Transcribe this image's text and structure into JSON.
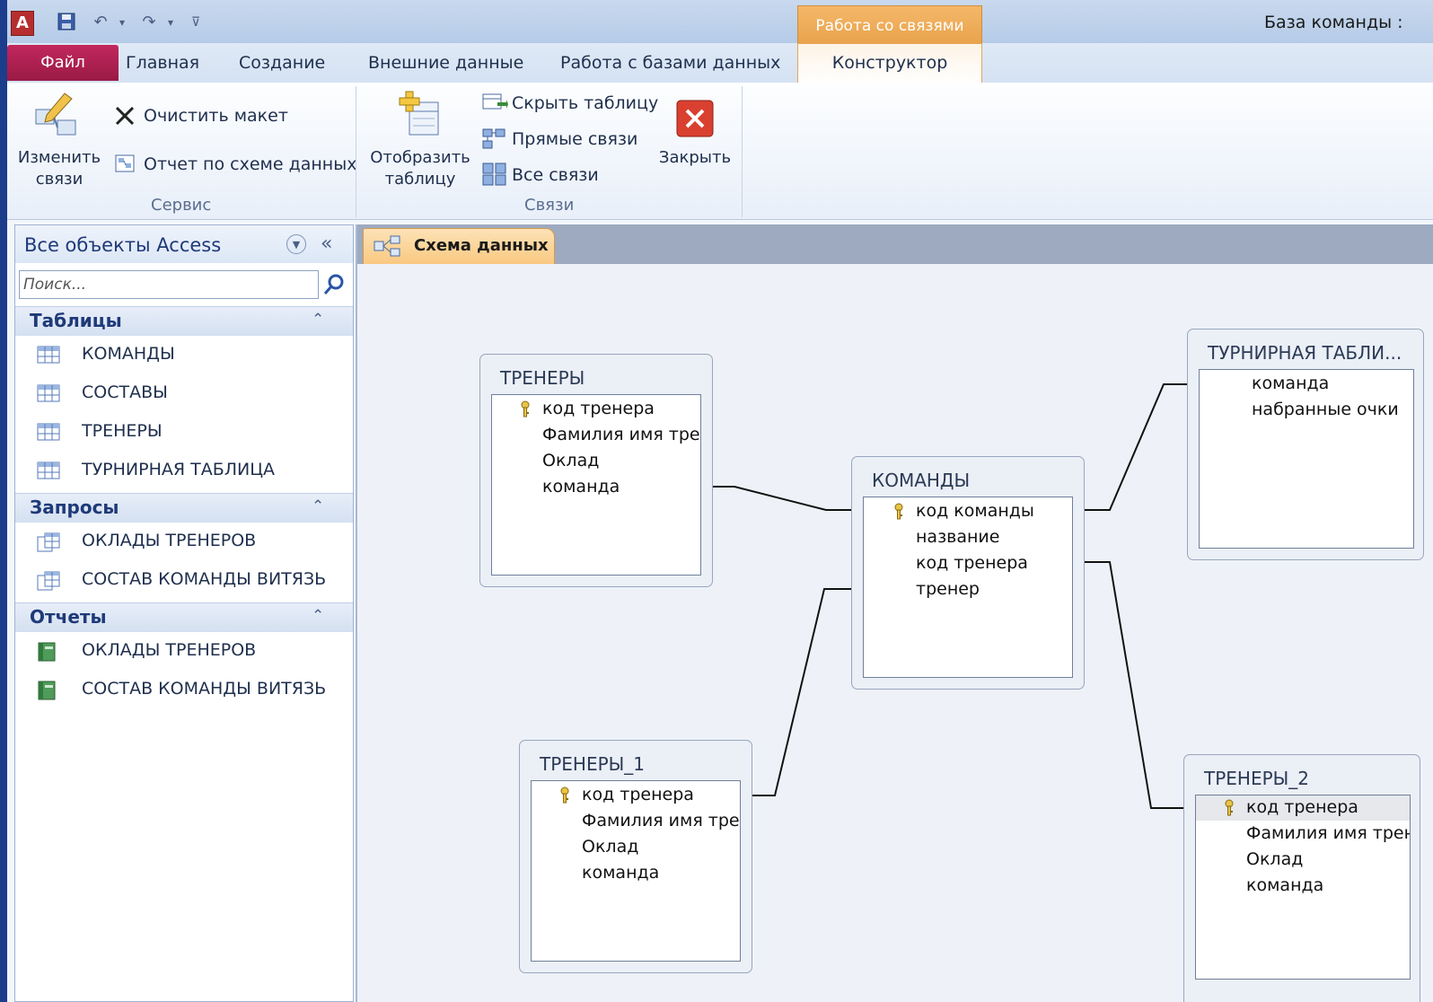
{
  "titlebar": {
    "app_icon": "A",
    "context_group": "Работа со связями",
    "window_title": "База команды : "
  },
  "tabs": {
    "file": "Файл",
    "home": "Главная",
    "create": "Создание",
    "external": "Внешние данные",
    "database": "Работа с базами данных",
    "constructor": "Конструктор"
  },
  "ribbon": {
    "edit_links_line1": "Изменить",
    "edit_links_line2": "связи",
    "clear_layout": "Очистить макет",
    "schema_report": "Отчет по схеме данных",
    "group_service": "Сервис",
    "show_table_line1": "Отобразить",
    "show_table_line2": "таблицу",
    "hide_table": "Скрыть таблицу",
    "direct_links": "Прямые связи",
    "all_links": "Все связи",
    "close": "Закрыть",
    "group_links": "Связи"
  },
  "nav": {
    "title": "Все объекты Access",
    "search_placeholder": "Поиск...",
    "sections": [
      {
        "label": "Таблицы",
        "items": [
          "КОМАНДЫ",
          "СОСТАВЫ",
          "ТРЕНЕРЫ",
          "ТУРНИРНАЯ ТАБЛИЦА"
        ]
      },
      {
        "label": "Запросы",
        "items": [
          "ОКЛАДЫ ТРЕНЕРОВ",
          "СОСТАВ КОМАНДЫ ВИТЯЗЬ"
        ]
      },
      {
        "label": "Отчеты",
        "items": [
          "ОКЛАДЫ ТРЕНЕРОВ",
          "СОСТАВ КОМАНДЫ ВИТЯЗЬ"
        ]
      }
    ]
  },
  "document": {
    "tab_label": "Схема данных"
  },
  "tables": {
    "trenery": {
      "title": "ТРЕНЕРЫ",
      "fields": [
        "код тренера",
        "Фамилия имя трен",
        "Оклад",
        "команда"
      ]
    },
    "komandy": {
      "title": "КОМАНДЫ",
      "fields": [
        "код команды",
        "название",
        "код тренера",
        "тренер"
      ]
    },
    "turnir": {
      "title": "ТУРНИРНАЯ ТАБЛИ...",
      "fields": [
        "команда",
        "набранные очки"
      ]
    },
    "trenery1": {
      "title": "ТРЕНЕРЫ_1",
      "fields": [
        "код тренера",
        "Фамилия имя трен",
        "Оклад",
        "команда"
      ]
    },
    "trenery2": {
      "title": "ТРЕНЕРЫ_2",
      "fields": [
        "код тренера",
        "Фамилия имя трен",
        "Оклад",
        "команда"
      ]
    }
  },
  "icons": {
    "nav_table_icon": "table-icon",
    "nav_query_icon": "query-icon",
    "nav_report_icon": "report-icon",
    "primary_key_icon": "key-icon"
  },
  "colors": {
    "file_tab": "#b0214f",
    "context_tab": "#eda651",
    "section_header_text": "#1f3a78"
  }
}
